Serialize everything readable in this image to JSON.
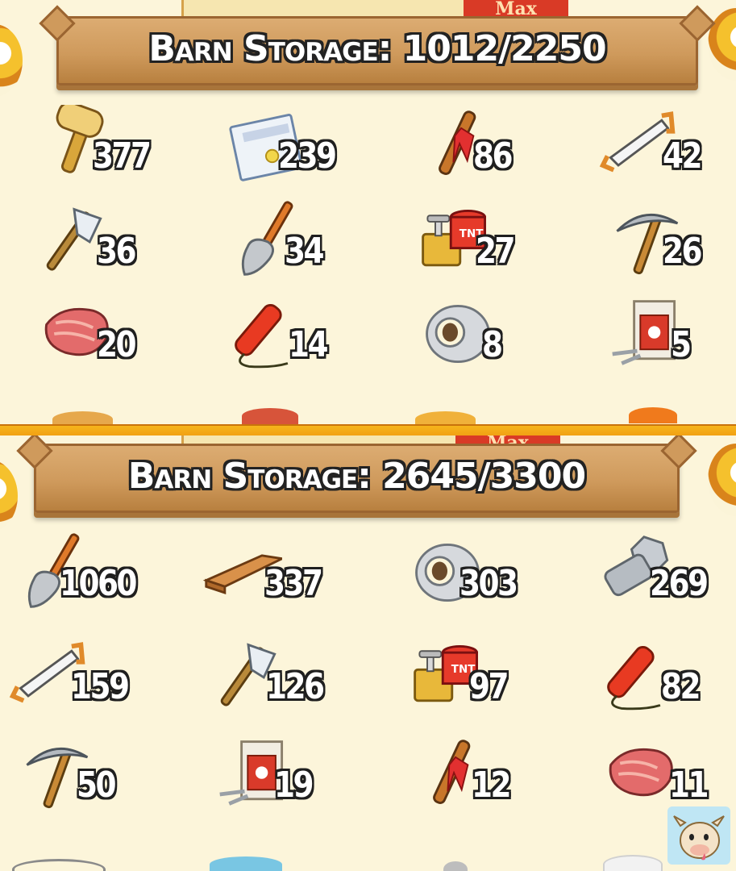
{
  "panels": [
    {
      "max_label": "Max",
      "title": "Barn Storage: 1012/2250",
      "items": [
        {
          "icon": "mallet-icon",
          "count": "377"
        },
        {
          "icon": "land-deed-icon",
          "count": "239"
        },
        {
          "icon": "marker-stake-icon",
          "count": "86"
        },
        {
          "icon": "saw-icon",
          "count": "42"
        },
        {
          "icon": "axe-icon",
          "count": "36"
        },
        {
          "icon": "shovel-icon",
          "count": "34"
        },
        {
          "icon": "tnt-detonator-icon",
          "count": "27"
        },
        {
          "icon": "pickaxe-icon",
          "count": "26"
        },
        {
          "icon": "meat-icon",
          "count": "20"
        },
        {
          "icon": "dynamite-icon",
          "count": "14"
        },
        {
          "icon": "duct-tape-icon",
          "count": "8"
        },
        {
          "icon": "nail-box-icon",
          "count": "5"
        }
      ]
    },
    {
      "max_label": "Max",
      "title": "Barn Storage: 2645/3300",
      "items": [
        {
          "icon": "shovel-icon",
          "count": "1060"
        },
        {
          "icon": "wood-plank-icon",
          "count": "337"
        },
        {
          "icon": "duct-tape-icon",
          "count": "303"
        },
        {
          "icon": "bolt-icon",
          "count": "269"
        },
        {
          "icon": "saw-icon",
          "count": "159"
        },
        {
          "icon": "axe-icon",
          "count": "126"
        },
        {
          "icon": "tnt-detonator-icon",
          "count": "97"
        },
        {
          "icon": "dynamite-icon",
          "count": "82"
        },
        {
          "icon": "pickaxe-icon",
          "count": "50"
        },
        {
          "icon": "nail-box-icon",
          "count": "19"
        },
        {
          "icon": "marker-stake-icon",
          "count": "12"
        },
        {
          "icon": "meat-icon",
          "count": "11"
        }
      ]
    }
  ]
}
